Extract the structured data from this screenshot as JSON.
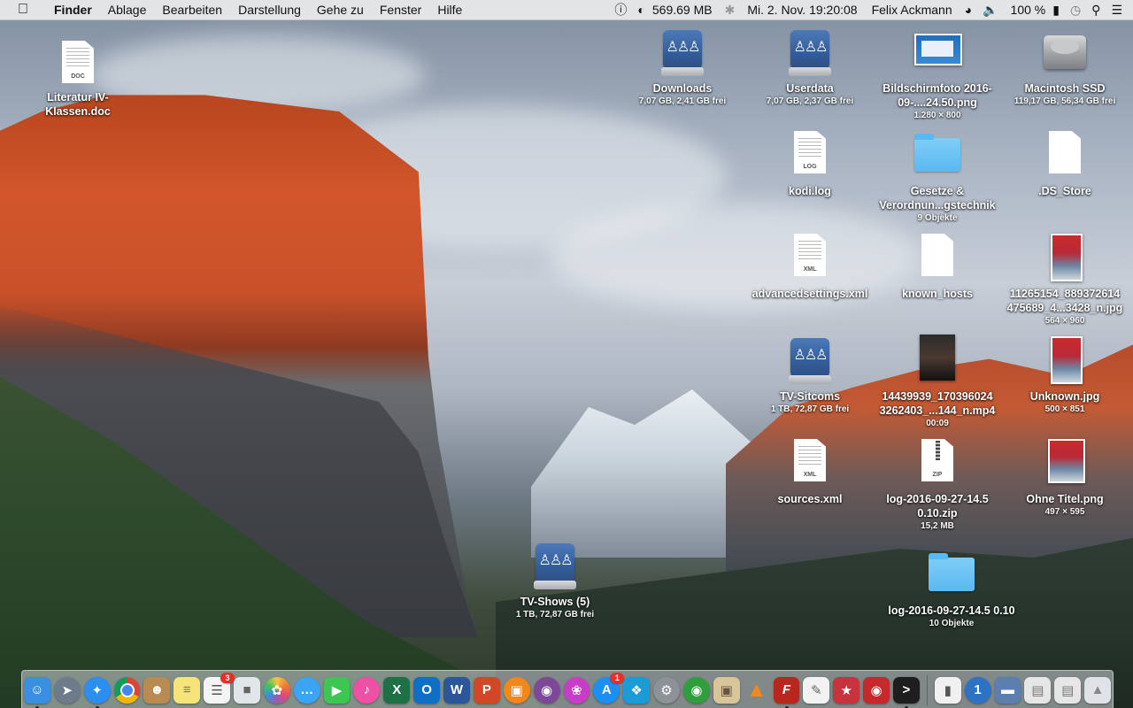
{
  "menubar": {
    "apple_icon": "apple-logo",
    "app_name": "Finder",
    "menus": [
      "Ablage",
      "Bearbeiten",
      "Darstellung",
      "Gehe zu",
      "Fenster",
      "Hilfe"
    ],
    "memory": "569.69 MB",
    "datetime": "Mi. 2. Nov.  19:20:08",
    "user": "Felix Ackmann",
    "battery": "100 %",
    "status_icons": [
      "info-circle-icon",
      "memory-gauge-icon",
      "bluetooth-icon",
      "wifi-icon",
      "volume-icon",
      "battery-icon",
      "time-machine-icon",
      "spotlight-search-icon",
      "notification-center-icon"
    ]
  },
  "desktop_icons": {
    "literatur": {
      "label": "Literatur IV-Klassen.doc",
      "tag": "DOC"
    },
    "downloads": {
      "label": "Downloads",
      "sub": "7,07 GB, 2,41 GB frei"
    },
    "userdata": {
      "label": "Userdata",
      "sub": "7,07 GB, 2,37 GB frei"
    },
    "bildschirmfoto": {
      "label": "Bildschirmfoto 2016-09-....24.50.png",
      "sub": "1.280 × 800"
    },
    "macintosh_ssd": {
      "label": "Macintosh SSD",
      "sub": "119,17 GB, 56,34 GB frei"
    },
    "kodi_log": {
      "label": "kodi.log",
      "tag": "LOG"
    },
    "gesetze": {
      "label": "Gesetze & Verordnun...gstechnik",
      "sub": "9 Objekte"
    },
    "ds_store": {
      "label": ".DS_Store"
    },
    "advancedsettings": {
      "label": "advancedsettings.xml",
      "tag": "XML"
    },
    "known_hosts": {
      "label": "known_hosts"
    },
    "jpg_11265154": {
      "label": "11265154_889372614 475689_4...3428_n.jpg",
      "sub": "564 × 960"
    },
    "tv_sitcoms": {
      "label": "TV-Sitcoms",
      "sub": "1 TB, 72,87 GB frei"
    },
    "mp4_14439939": {
      "label": "14439939_170396024 3262403_...144_n.mp4",
      "sub": "00:09"
    },
    "unknown_jpg": {
      "label": "Unknown.jpg",
      "sub": "500 × 851"
    },
    "sources_xml": {
      "label": "sources.xml",
      "tag": "XML"
    },
    "log_zip": {
      "label": "log-2016-09-27-14.5 0.10.zip",
      "sub": "15,2 MB",
      "tag": "ZIP"
    },
    "ohne_titel": {
      "label": "Ohne Titel.png",
      "sub": "497 × 595"
    },
    "tv_shows": {
      "label": "TV-Shows (5)",
      "sub": "1 TB, 72,87 GB frei"
    },
    "log_folder": {
      "label": "log-2016-09-27-14.5 0.10",
      "sub": "10 Objekte"
    }
  },
  "dock": {
    "badges": {
      "calendar": "3",
      "app_store": "1"
    },
    "colors": {
      "finder": "#3b8fe0",
      "launchpad": "#6e7b8c",
      "safari": "#2a8ff0",
      "chrome": "#e8e8e8",
      "contacts": "#b98a52",
      "notes": "#f6e37a",
      "reminders": "#f4f4f4",
      "photos": "#ffffff",
      "messages": "#3aa4f5",
      "facetime": "#3ec653",
      "itunes": "#ef4fa5",
      "excel": "#1e7145",
      "outlook": "#0f6fc6",
      "word": "#2b579a",
      "powerpoint": "#d24726",
      "ibooks": "#f2881c",
      "tor": "#7e4798",
      "flower": "#c93cc8",
      "app_store": "#1b8ff2",
      "kodi": "#1c9bd7",
      "system_prefs": "#8d9299",
      "coin": "#2f9f3e",
      "preview": "#d9c59a",
      "vlc": "#f28a1b",
      "filezilla": "#b8261e",
      "textedit": "#f2f2f2",
      "game": "#c8323c",
      "photobooth": "#c7282c",
      "terminal": "#1e1e1e",
      "zip": "#f0f0f0",
      "onepassword": "#2e72c4",
      "bar1": "#5d7fb0",
      "bar2": "#e6e6e6",
      "bar3": "#e6e6e6",
      "trash": "#dfe3e7"
    }
  }
}
